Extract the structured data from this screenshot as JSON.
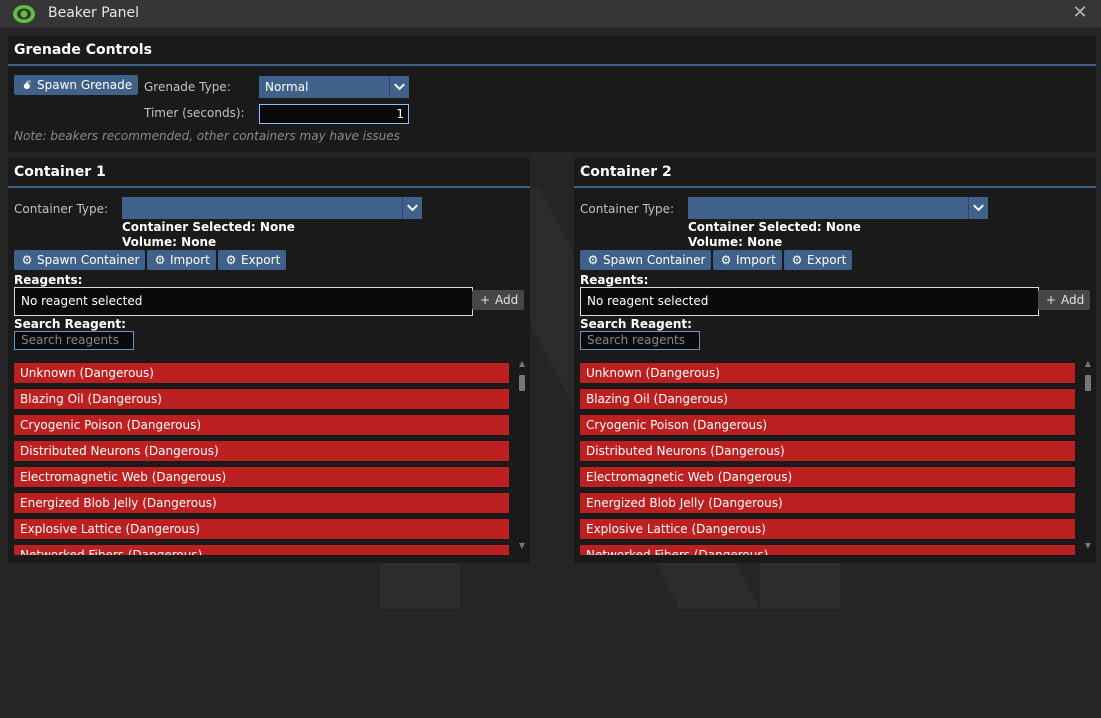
{
  "window": {
    "title": "Beaker Panel",
    "icon": "eye-icon",
    "close_label": "✕"
  },
  "grenade": {
    "heading": "Grenade Controls",
    "spawn_label": "Spawn Grenade",
    "type_label": "Grenade Type:",
    "type_value": "Normal",
    "timer_label": "Timer (seconds):",
    "timer_value": "1",
    "note": "Note: beakers recommended, other containers may have issues"
  },
  "containers": [
    {
      "heading": "Container 1",
      "type_label": "Container Type:",
      "type_value": "",
      "selected_text": "Container Selected: None",
      "volume_text": "Volume: None",
      "spawn_label": "Spawn Container",
      "import_label": "Import",
      "export_label": "Export",
      "reagents_label": "Reagents:",
      "reagent_value": "No reagent selected",
      "add_label": "Add",
      "search_label": "Search Reagent:",
      "search_placeholder": "Search reagents",
      "items": [
        "Unknown (Dangerous)",
        "Blazing Oil (Dangerous)",
        "Cryogenic Poison (Dangerous)",
        "Distributed Neurons (Dangerous)",
        "Electromagnetic Web (Dangerous)",
        "Energized Blob Jelly (Dangerous)",
        "Explosive Lattice (Dangerous)",
        "Networked Fibers (Dangerous)"
      ]
    },
    {
      "heading": "Container 2",
      "type_label": "Container Type:",
      "type_value": "",
      "selected_text": "Container Selected: None",
      "volume_text": "Volume: None",
      "spawn_label": "Spawn Container",
      "import_label": "Import",
      "export_label": "Export",
      "reagents_label": "Reagents:",
      "reagent_value": "No reagent selected",
      "add_label": "Add",
      "search_label": "Search Reagent:",
      "search_placeholder": "Search reagents",
      "items": [
        "Unknown (Dangerous)",
        "Blazing Oil (Dangerous)",
        "Cryogenic Poison (Dangerous)",
        "Distributed Neurons (Dangerous)",
        "Electromagnetic Web (Dangerous)",
        "Energized Blob Jelly (Dangerous)",
        "Explosive Lattice (Dangerous)",
        "Networked Fibers (Dangerous)"
      ]
    }
  ],
  "colors": {
    "accent": "#40628a",
    "danger": "#bd2020",
    "background": "#252525",
    "section": "#1a1a1a",
    "icon_green": "#5fbf3f"
  }
}
